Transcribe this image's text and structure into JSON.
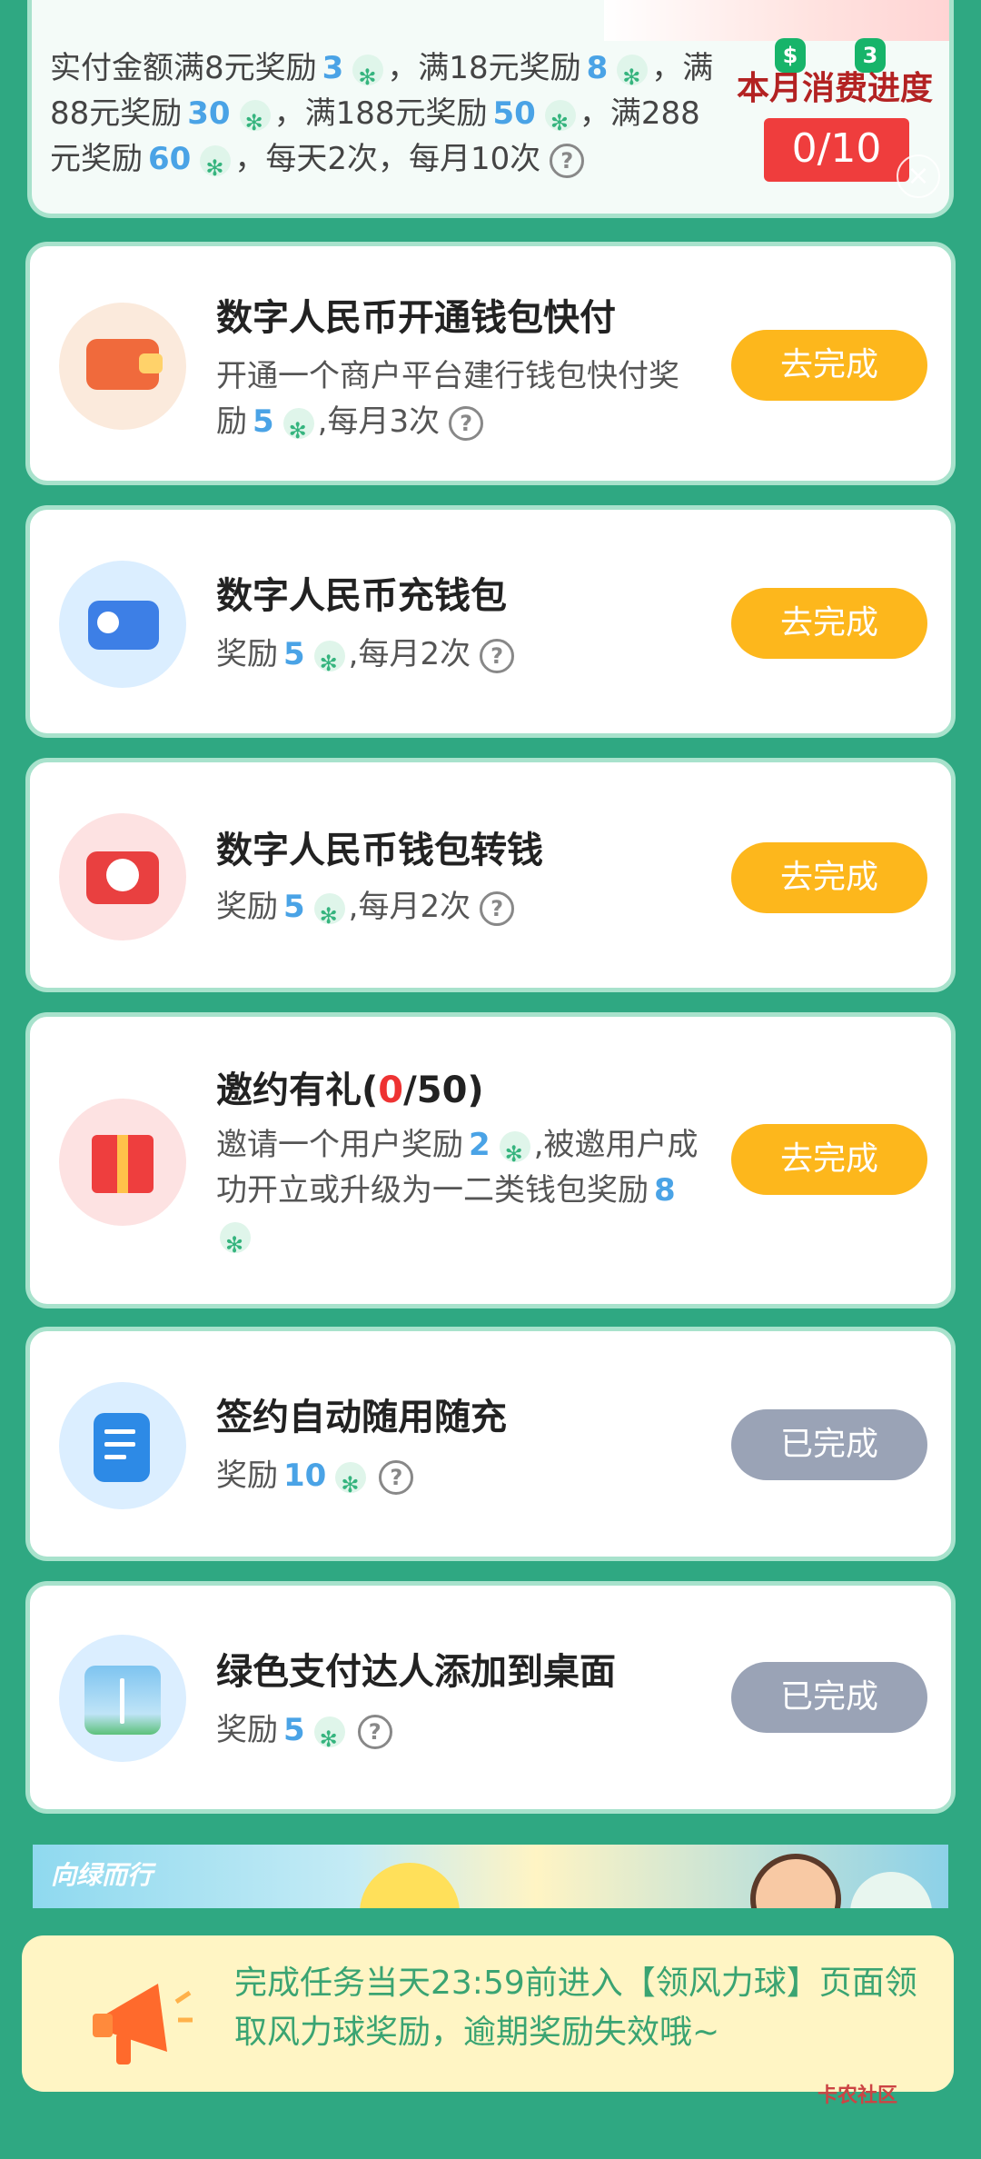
{
  "top_card": {
    "segments": [
      {
        "text": "实付金额满8元奖励"
      },
      {
        "num": "3"
      },
      {
        "text": "，满18元奖励"
      },
      {
        "num": "8"
      },
      {
        "text": "，满88元奖励"
      },
      {
        "num": "30"
      },
      {
        "text": "，满188元奖励"
      },
      {
        "num": "50"
      },
      {
        "text": "，满288元奖励"
      },
      {
        "num": "60"
      },
      {
        "text": "，每天2次，每月10次"
      }
    ],
    "monthly_title": "本月消费进度",
    "progress": "0/10",
    "badge_dollar": "$",
    "badge_three": "3",
    "close_glyph": "×"
  },
  "tasks": [
    {
      "title": "数字人民币开通钱包快付",
      "desc_prefix": "开通一个商户平台建行钱包快付奖励",
      "num": "5",
      "desc_suffix": ",每月3次",
      "button": "去完成"
    },
    {
      "title": "数字人民币充钱包",
      "desc_prefix": "奖励",
      "num": "5",
      "desc_suffix": ",每月2次",
      "button": "去完成"
    },
    {
      "title": "数字人民币钱包转钱",
      "desc_prefix": "奖励",
      "num": "5",
      "desc_suffix": ",每月2次",
      "button": "去完成"
    },
    {
      "title_prefix": "邀约有礼(",
      "title_count": "0",
      "title_suffix": "/50)",
      "desc_prefix": "邀请一个用户奖励",
      "num": "2",
      "desc_mid": ",被邀用户成功开立或升级为一二类钱包奖励",
      "num2": "8",
      "button": "去完成"
    },
    {
      "title": "签约自动随用随充",
      "desc_prefix": "奖励",
      "num": "10",
      "desc_suffix": "",
      "button": "已完成"
    },
    {
      "title": "绿色支付达人添加到桌面",
      "desc_prefix": "奖励",
      "num": "5",
      "desc_suffix": "",
      "button": "已完成"
    }
  ],
  "banner": {
    "logo": "向绿而行"
  },
  "notice": {
    "text": "完成任务当天23:59前进入【领风力球】页面领取风力球奖励，逾期奖励失效哦~"
  },
  "watermark": "卡农社区",
  "question_glyph": "?"
}
